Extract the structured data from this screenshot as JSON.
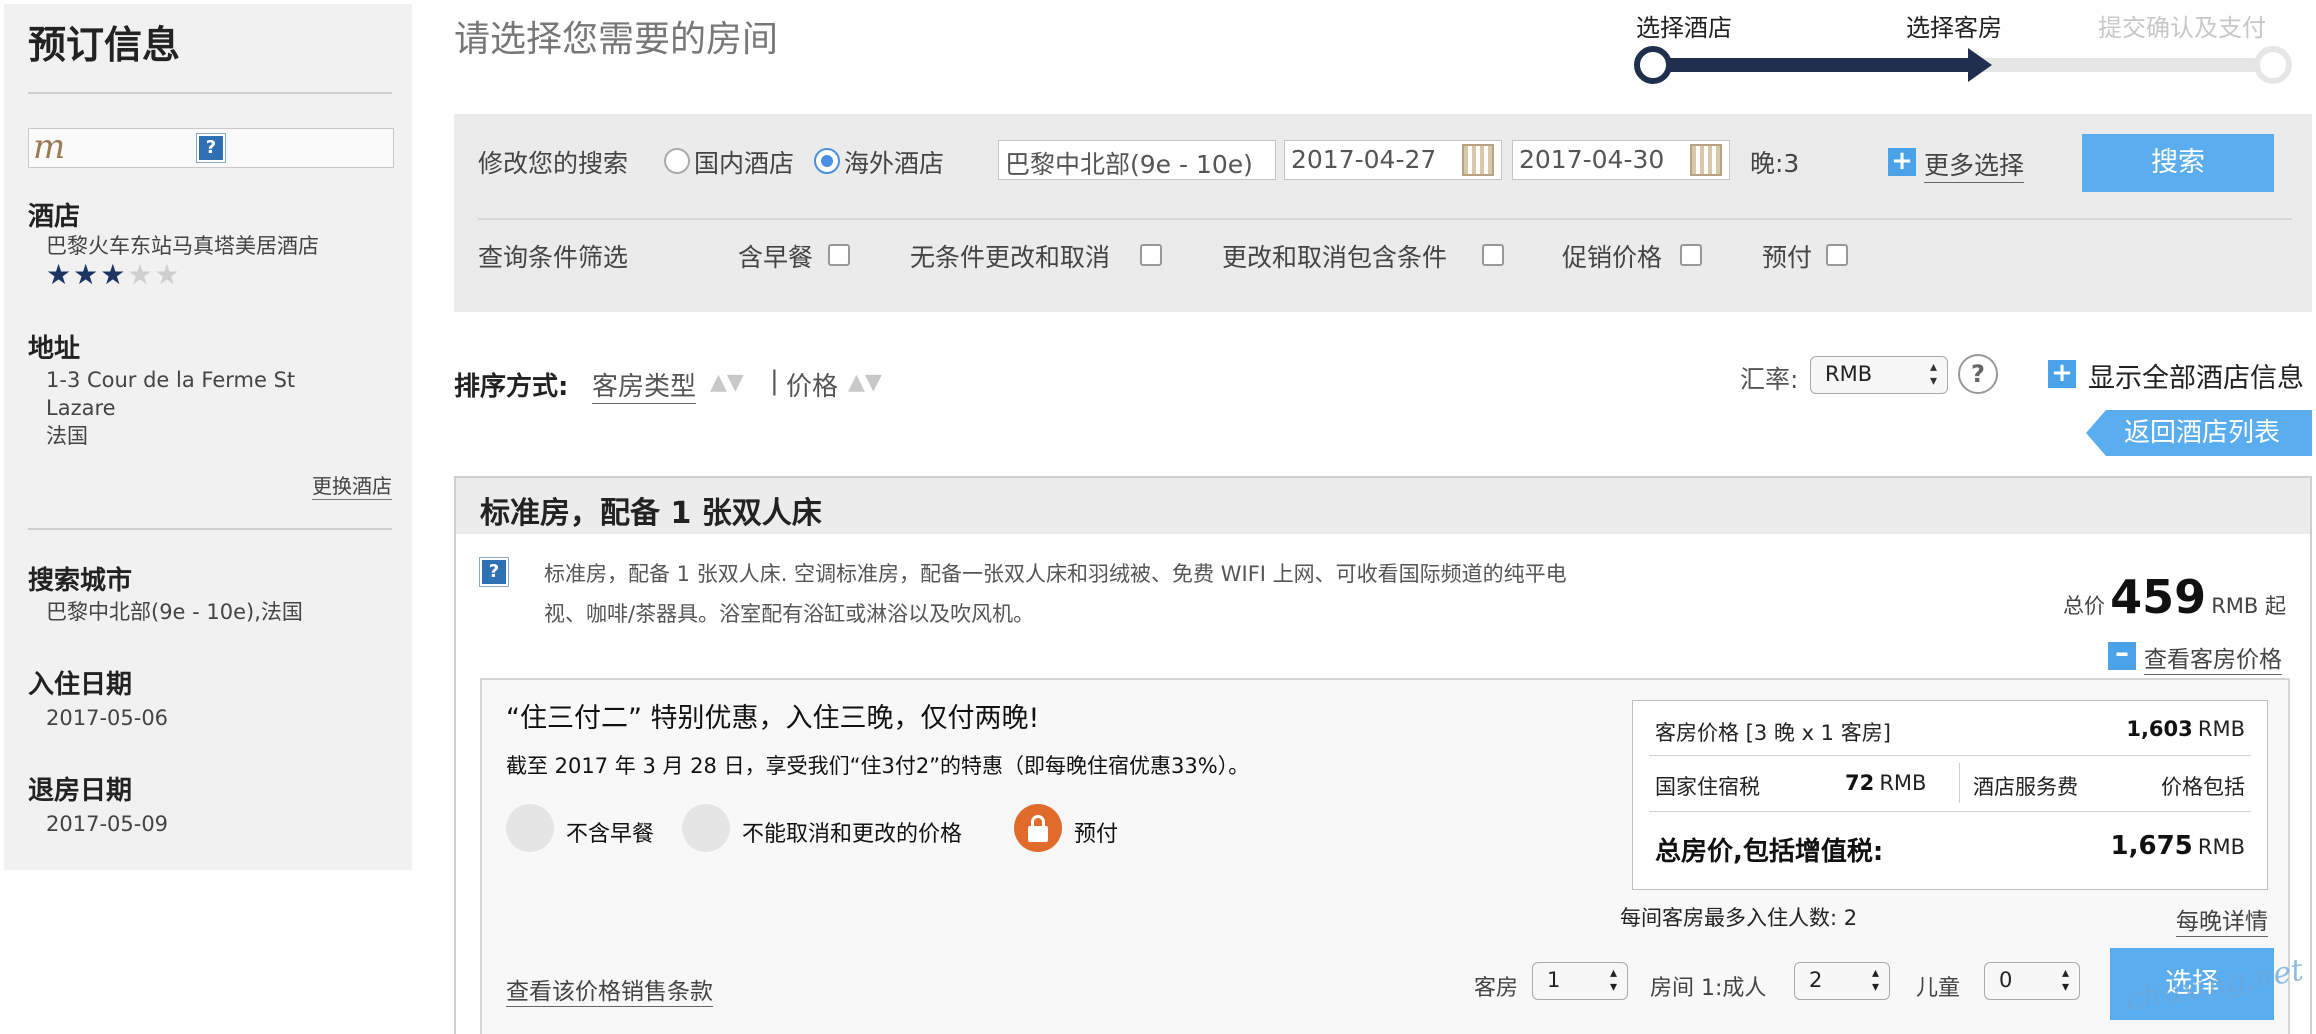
{
  "sidebar": {
    "title": "预订信息",
    "logo_letter": "m",
    "help_glyph": "?",
    "hotel_label": "酒店",
    "hotel_name": "巴黎火车东站马真塔美居酒店",
    "stars_filled": "★★★",
    "stars_empty": "★★",
    "address_label": "地址",
    "address_line1": "1-3 Cour de la Ferme St",
    "address_line2": "Lazare",
    "address_line3": "法国",
    "change_hotel": "更换酒店",
    "city_label": "搜索城市",
    "city_value": "巴黎中北部(9e - 10e),法国",
    "checkin_label": "入住日期",
    "checkin_value": "2017-05-06",
    "checkout_label": "退房日期",
    "checkout_value": "2017-05-09"
  },
  "header": {
    "page_title": "请选择您需要的房间",
    "steps": [
      "选择酒店",
      "选择客房",
      "提交确认及支付"
    ]
  },
  "search": {
    "modify_label": "修改您的搜索",
    "radio_domestic": "国内酒店",
    "radio_overseas": "海外酒店",
    "destination": "巴黎中北部(9e - 10e)",
    "checkin": "2017-04-27",
    "checkout": "2017-04-30",
    "nights": "晚:3",
    "more_options": "更多选择",
    "search_button": "搜索",
    "filter_label": "查询条件筛选",
    "filters": [
      "含早餐",
      "无条件更改和取消",
      "更改和取消包含条件",
      "促销价格",
      "预付"
    ]
  },
  "sort": {
    "label": "排序方式:",
    "by_room_type": "客房类型",
    "by_price": "价格",
    "currency_label": "汇率:",
    "currency": "RMB",
    "show_all_info": "显示全部酒店信息",
    "back_to_list": "返回酒店列表"
  },
  "room": {
    "title": "标准房，配备 1 张双人床",
    "description": "标准房，配备 1 张双人床. 空调标准房，配备一张双人床和羽绒被、免费 WIFI 上网、可收看国际频道的纯平电视、咖啡/茶器具。浴室配有浴缸或淋浴以及吹风机。",
    "total_label": "总价",
    "total_price": "459",
    "total_suffix": "RMB 起",
    "view_prices": "查看客房价格"
  },
  "rate": {
    "title": "“住三付二” 特别优惠，入住三晚，仅付两晚!",
    "subtitle": "截至 2017 年 3 月 28 日，享受我们“住3付2”的特惠（即每晚住宿优惠33%）。",
    "features": [
      "不含早餐",
      "不能取消和更改的价格",
      "预付"
    ],
    "breakdown": {
      "room_price_label": "客房价格 [3 晚 x 1 客房]",
      "room_price_value": "1,603",
      "currency": "RMB",
      "tax_label": "国家住宿税",
      "tax_value": "72",
      "service_label": "酒店服务费",
      "service_value": "价格包括",
      "total_label": "总房价,包括增值税:",
      "total_value": "1,675"
    },
    "max_guests": "每间客房最多入住人数: 2",
    "nightly_details": "每晚详情",
    "sales_terms": "查看该价格销售条款",
    "rooms_label": "客房",
    "rooms_value": "1",
    "adults_label": "房间 1:成人",
    "adults_value": "2",
    "children_label": "儿童",
    "children_value": "0",
    "select_button": "选择"
  },
  "watermark": "chuxing.net"
}
